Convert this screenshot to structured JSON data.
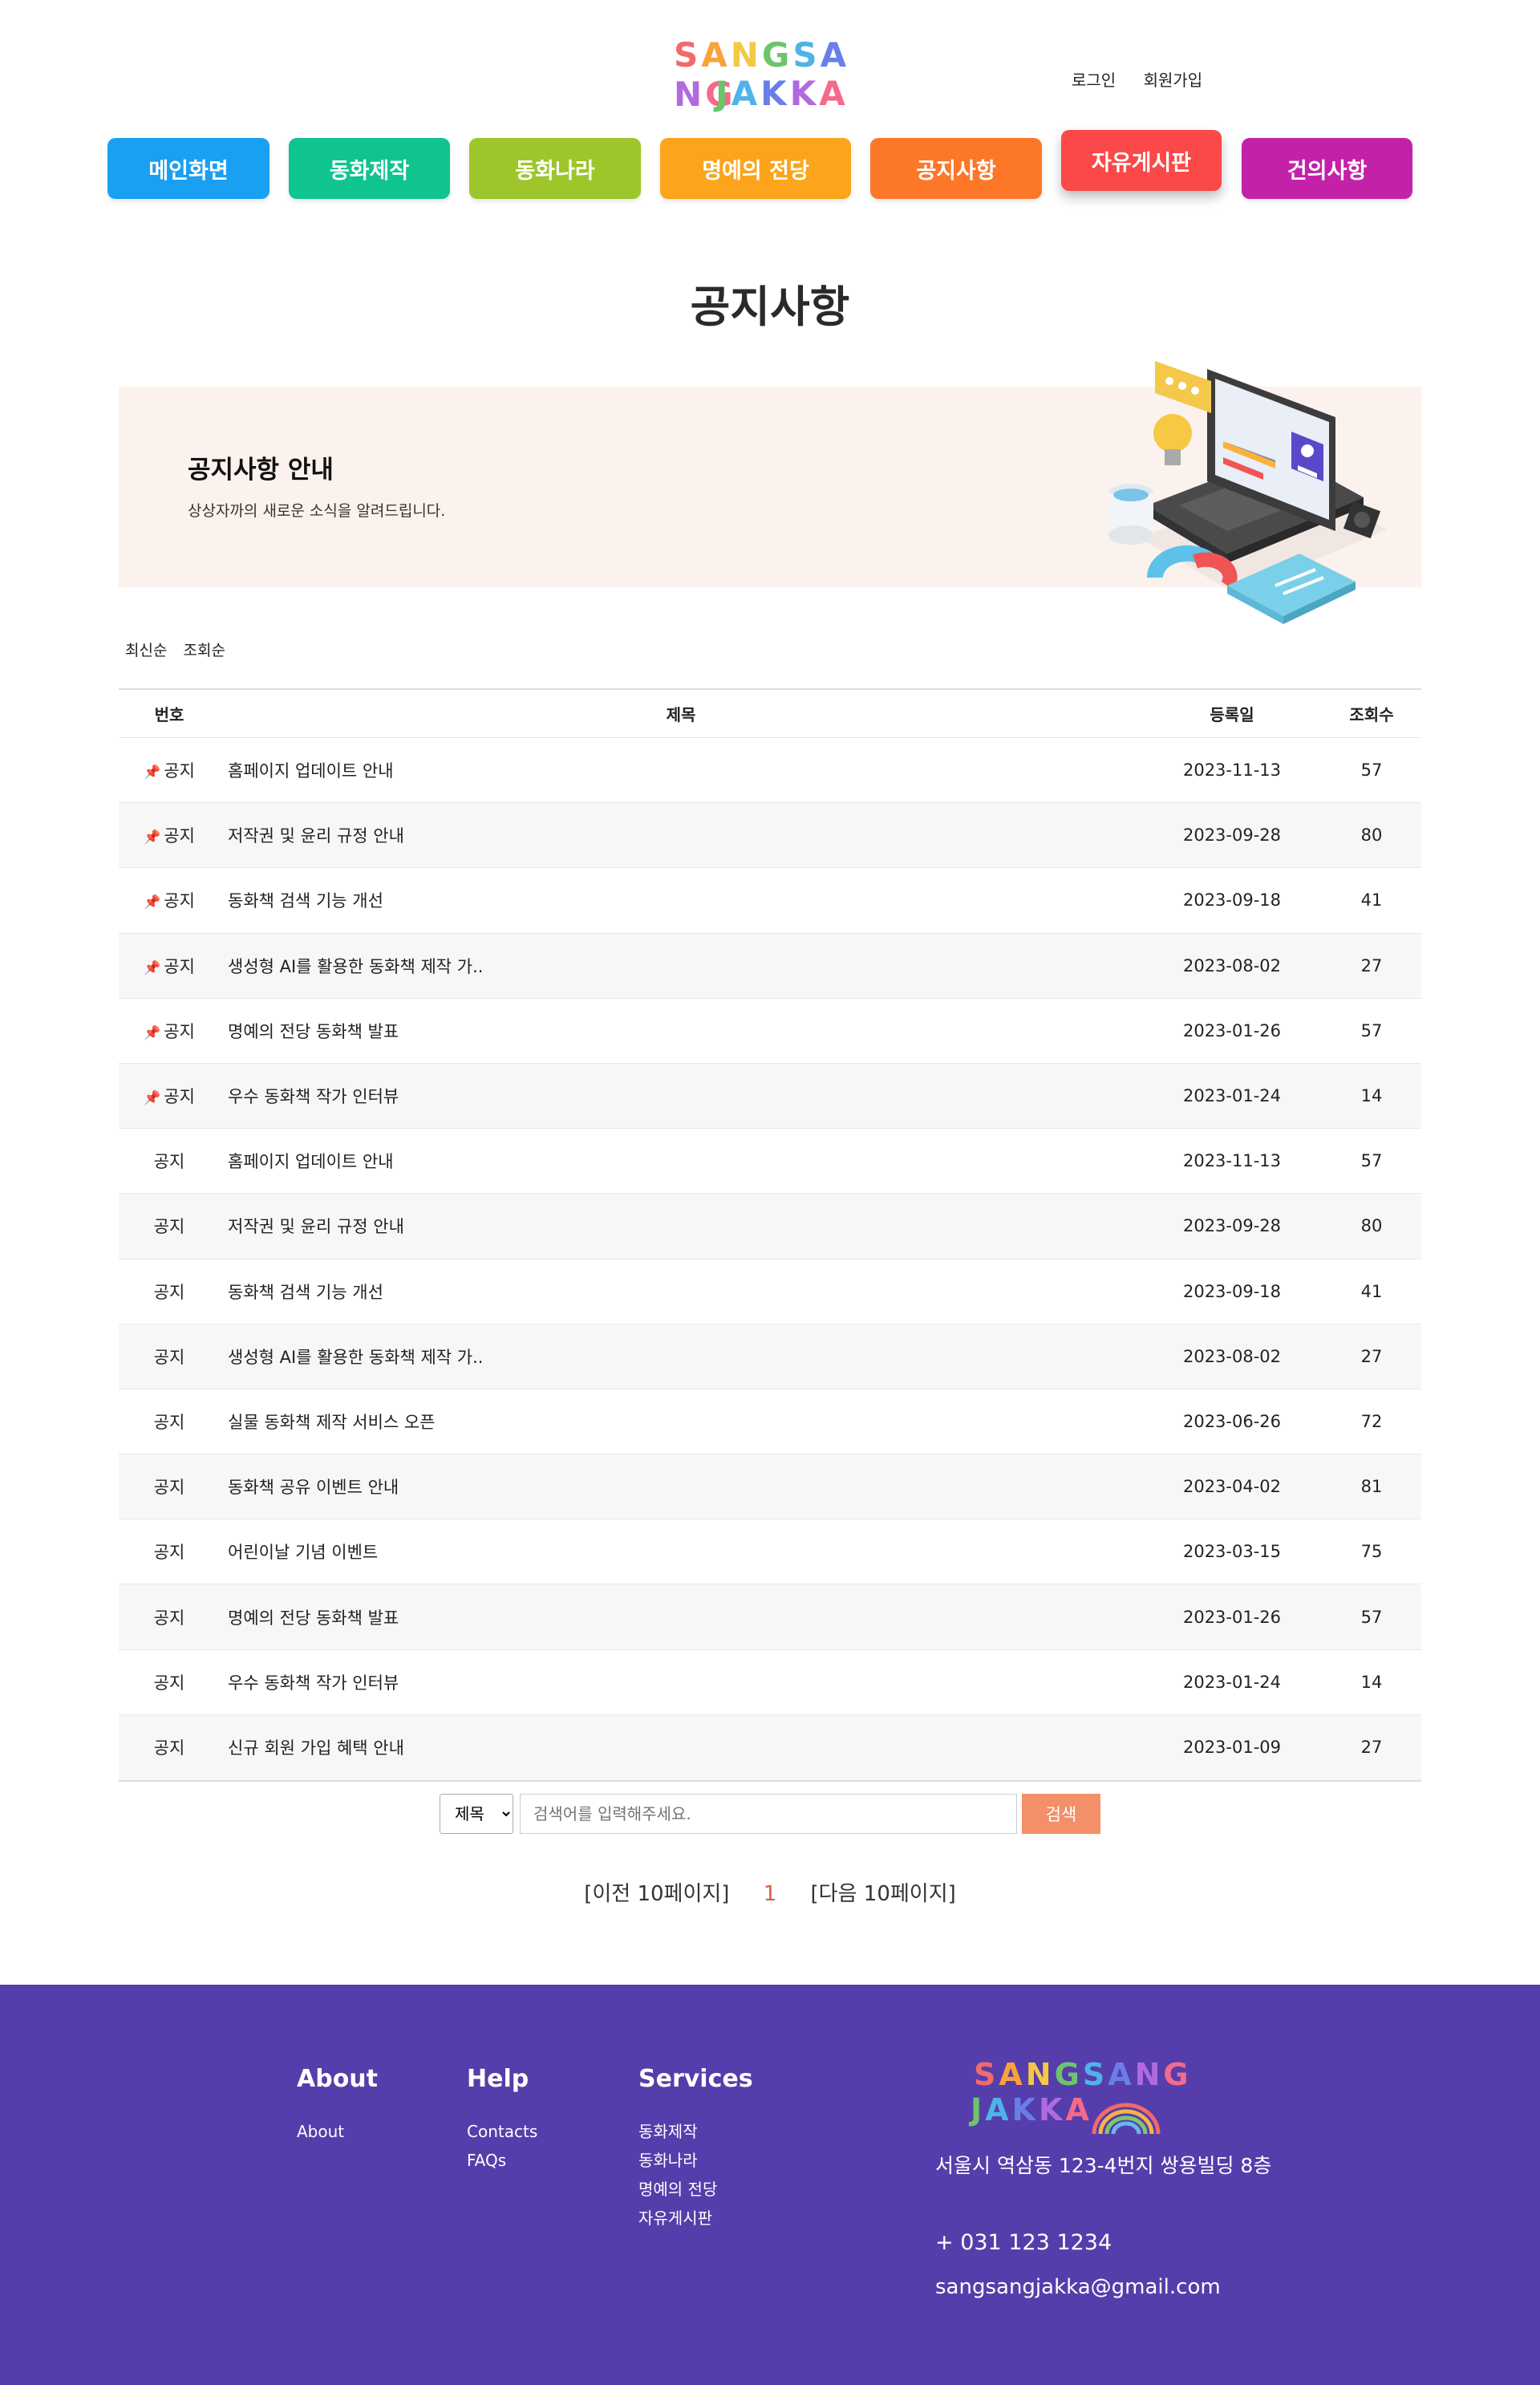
{
  "header": {
    "logo_line1": "SANGSANG",
    "logo_line2": "JAKKA",
    "login": "로그인",
    "signup": "회원가입"
  },
  "nav": [
    {
      "label": "메인화면",
      "color": "#1aa0f0"
    },
    {
      "label": "동화제작",
      "color": "#10c48f"
    },
    {
      "label": "동화나라",
      "color": "#9cc62a"
    },
    {
      "label": "명예의 전당",
      "color": "#fba41c"
    },
    {
      "label": "공지사항",
      "color": "#fd7728"
    },
    {
      "label": "자유게시판",
      "color": "#fb4849"
    },
    {
      "label": "건의사항",
      "color": "#c322a8"
    }
  ],
  "page_title": "공지사항",
  "banner": {
    "title": "공지사항 안내",
    "subtitle": "상상자까의 새로운 소식을 알려드립니다."
  },
  "sort": [
    "최신순",
    "조회순"
  ],
  "table": {
    "headers": {
      "no": "번호",
      "title": "제목",
      "date": "등록일",
      "views": "조회수"
    },
    "rows": [
      {
        "no": "공지",
        "pinned": true,
        "title": "홈페이지 업데이트 안내",
        "date": "2023-11-13",
        "views": "57"
      },
      {
        "no": "공지",
        "pinned": true,
        "title": "저작권 및 윤리 규정 안내",
        "date": "2023-09-28",
        "views": "80"
      },
      {
        "no": "공지",
        "pinned": true,
        "title": "동화책 검색 기능 개선",
        "date": "2023-09-18",
        "views": "41"
      },
      {
        "no": "공지",
        "pinned": true,
        "title": "생성형 AI를 활용한 동화책 제작 가..",
        "date": "2023-08-02",
        "views": "27"
      },
      {
        "no": "공지",
        "pinned": true,
        "title": "명예의 전당 동화책 발표",
        "date": "2023-01-26",
        "views": "57"
      },
      {
        "no": "공지",
        "pinned": true,
        "title": "우수 동화책 작가 인터뷰",
        "date": "2023-01-24",
        "views": "14"
      },
      {
        "no": "공지",
        "pinned": false,
        "title": "홈페이지 업데이트 안내",
        "date": "2023-11-13",
        "views": "57"
      },
      {
        "no": "공지",
        "pinned": false,
        "title": "저작권 및 윤리 규정 안내",
        "date": "2023-09-28",
        "views": "80"
      },
      {
        "no": "공지",
        "pinned": false,
        "title": "동화책 검색 기능 개선",
        "date": "2023-09-18",
        "views": "41"
      },
      {
        "no": "공지",
        "pinned": false,
        "title": "생성형 AI를 활용한 동화책 제작 가..",
        "date": "2023-08-02",
        "views": "27"
      },
      {
        "no": "공지",
        "pinned": false,
        "title": "실물 동화책 제작 서비스 오픈",
        "date": "2023-06-26",
        "views": "72"
      },
      {
        "no": "공지",
        "pinned": false,
        "title": "동화책 공유 이벤트 안내",
        "date": "2023-04-02",
        "views": "81"
      },
      {
        "no": "공지",
        "pinned": false,
        "title": "어린이날 기념 이벤트",
        "date": "2023-03-15",
        "views": "75"
      },
      {
        "no": "공지",
        "pinned": false,
        "title": "명예의 전당 동화책 발표",
        "date": "2023-01-26",
        "views": "57"
      },
      {
        "no": "공지",
        "pinned": false,
        "title": "우수 동화책 작가 인터뷰",
        "date": "2023-01-24",
        "views": "14"
      },
      {
        "no": "공지",
        "pinned": false,
        "title": "신규 회원 가입 혜택 안내",
        "date": "2023-01-09",
        "views": "27"
      }
    ]
  },
  "search": {
    "select_value": "제목",
    "placeholder": "검색어를 입력해주세요.",
    "button": "검색"
  },
  "pager": {
    "prev": "[이전 10페이지]",
    "current": "1",
    "next": "[다음 10페이지]"
  },
  "footer": {
    "about_title": "About",
    "about_links": [
      "About"
    ],
    "help_title": "Help",
    "help_links": [
      "Contacts",
      "FAQs"
    ],
    "services_title": "Services",
    "services_links": [
      "동화제작",
      "동화나라",
      "명예의 전당",
      "자유게시판"
    ],
    "address": "서울시 역삼동 123-4번지 쌍용빌딩 8층",
    "phone": "+ 031 123 1234",
    "email": "sangsangjakka@gmail.com",
    "bg_color": "#553eab"
  }
}
